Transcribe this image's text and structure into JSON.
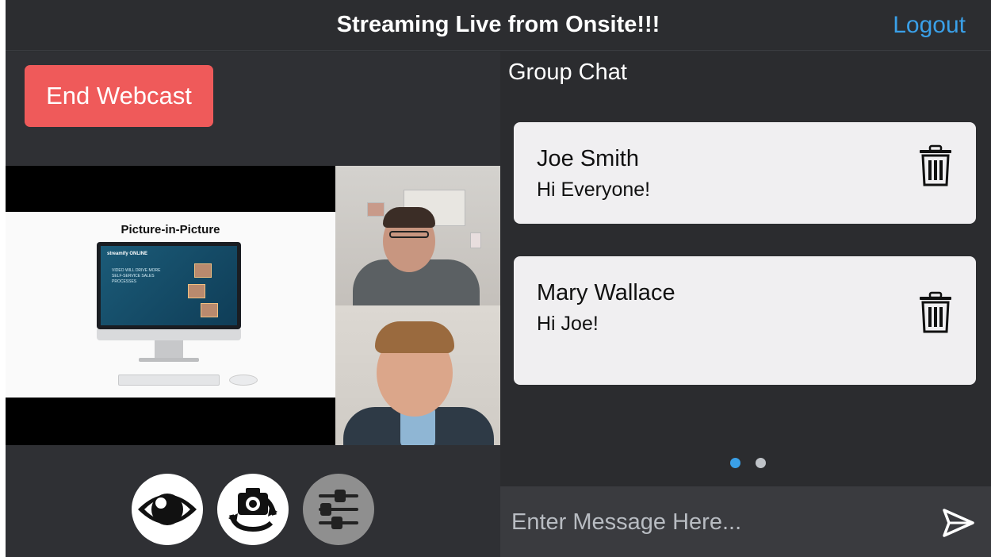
{
  "header": {
    "title": "Streaming Live from Onsite!!!",
    "logout_label": "Logout"
  },
  "left": {
    "end_button_label": "End Webcast",
    "slide": {
      "title": "Picture-in-Picture",
      "brand": "streamify ONLINE",
      "screen_text": "VIDEO WILL DRIVE MORE SELF-SERVICE SALES PROCESSES"
    },
    "controls": [
      {
        "name": "eye-icon"
      },
      {
        "name": "camera-switch-icon"
      },
      {
        "name": "sliders-icon"
      }
    ]
  },
  "chat": {
    "heading": "Group Chat",
    "messages": [
      {
        "name": "Joe Smith",
        "text": "Hi Everyone!"
      },
      {
        "name": "Mary Wallace",
        "text": "Hi Joe!"
      }
    ],
    "pagination": {
      "current": 1,
      "total": 2
    },
    "input_placeholder": "Enter Message Here...",
    "send_icon": "send-icon",
    "delete_icon": "trash-icon"
  },
  "colors": {
    "accent": "#3aa0e8",
    "end_button": "#ef5a5a",
    "background": "#2c2e31"
  }
}
